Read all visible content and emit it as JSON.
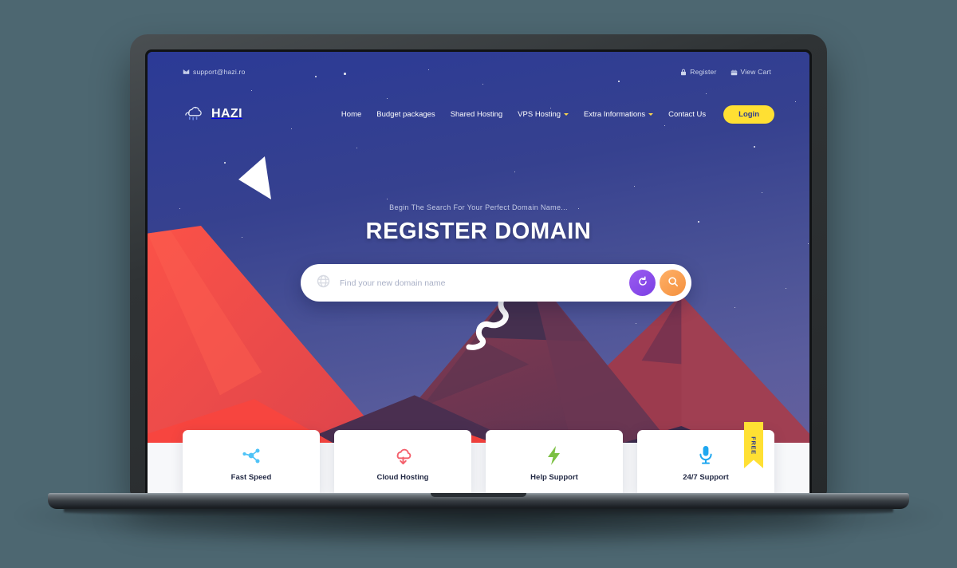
{
  "theme": {
    "page_background": "#4d6771",
    "sky_top": "#2b3a96",
    "sky_bottom": "#6a5f9c",
    "accent_yellow": "#ffe033",
    "accent_orange": "#f4913f",
    "accent_purple": "#7b3fe4",
    "mountain_red": "#f94a41",
    "mountain_maroon": "#8e3a4e",
    "mountain_dark": "#4a3550"
  },
  "topbar": {
    "email": "support@hazi.ro",
    "email_icon": "mail-icon",
    "register_label": "Register",
    "register_icon": "lock-icon",
    "cart_label": "View Cart",
    "cart_icon": "cart-icon"
  },
  "brand": {
    "name": "HAZI",
    "icon": "rain-cloud-icon"
  },
  "nav": {
    "items": [
      {
        "label": "Home",
        "has_caret": false
      },
      {
        "label": "Budget packages",
        "has_caret": false
      },
      {
        "label": "Shared Hosting",
        "has_caret": false
      },
      {
        "label": "VPS Hosting",
        "has_caret": true
      },
      {
        "label": "Extra Informations",
        "has_caret": true
      },
      {
        "label": "Contact Us",
        "has_caret": false
      }
    ],
    "login_label": "Login"
  },
  "hero": {
    "subtitle": "Begin The Search For Your Perfect Domain Name...",
    "title": "REGISTER DOMAIN"
  },
  "search": {
    "placeholder": "Find your new domain name",
    "value": "",
    "globe_icon": "globe-icon",
    "reset_icon": "refresh-icon",
    "submit_icon": "search-icon"
  },
  "cards": [
    {
      "title": "Fast Speed",
      "icon": "share-nodes-icon",
      "icon_color": "#4fc3f7",
      "badge": null
    },
    {
      "title": "Cloud Hosting",
      "icon": "cloud-download-icon",
      "icon_color": "#f4606c",
      "badge": null
    },
    {
      "title": "Help Support",
      "icon": "lightning-icon",
      "icon_color": "#7cc043",
      "badge": null
    },
    {
      "title": "24/7 Support",
      "icon": "microphone-icon",
      "icon_color": "#1fa7f0",
      "badge": "FREE"
    }
  ]
}
